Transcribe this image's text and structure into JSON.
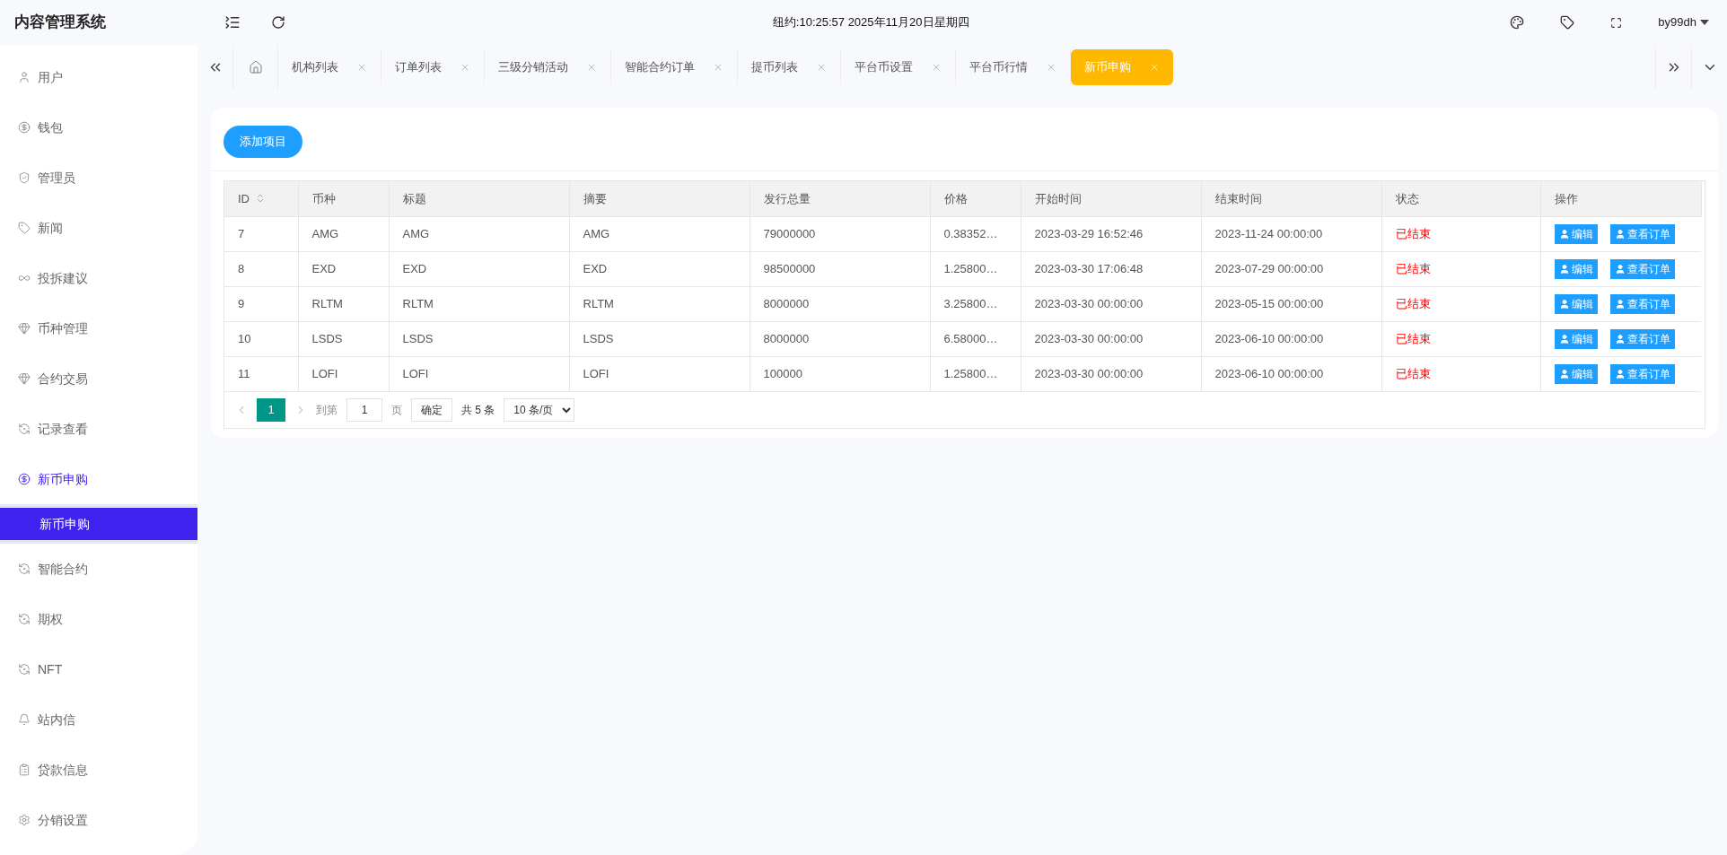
{
  "app_title": "内容管理系统",
  "header": {
    "clock": "纽约:10:25:57 2025年11月20日星期四",
    "user": "by99dh"
  },
  "sidebar": {
    "items": [
      {
        "label": "用户",
        "kind": "user",
        "expanded": false
      },
      {
        "label": "钱包",
        "kind": "dollar",
        "expanded": false
      },
      {
        "label": "管理员",
        "kind": "shield",
        "expanded": false
      },
      {
        "label": "新闻",
        "kind": "tag",
        "expanded": false
      },
      {
        "label": "投拆建议",
        "kind": "link",
        "expanded": false
      },
      {
        "label": "币种管理",
        "kind": "gem",
        "expanded": false
      },
      {
        "label": "合约交易",
        "kind": "gem",
        "expanded": false
      },
      {
        "label": "记录查看",
        "kind": "cycle",
        "expanded": false
      },
      {
        "label": "新币申购",
        "kind": "dollar",
        "expanded": true,
        "children": [
          {
            "label": "新币申购",
            "selected": true
          }
        ]
      },
      {
        "label": "智能合约",
        "kind": "cycle",
        "expanded": false
      },
      {
        "label": "期权",
        "kind": "cycle",
        "expanded": false
      },
      {
        "label": "NFT",
        "kind": "cycle",
        "expanded": false
      },
      {
        "label": "站内信",
        "kind": "bell",
        "expanded": false
      },
      {
        "label": "贷款信息",
        "kind": "clipboard",
        "expanded": false
      },
      {
        "label": "分销设置",
        "kind": "gear",
        "expanded": false
      }
    ]
  },
  "tabs": [
    {
      "label": "机构列表",
      "selected": false
    },
    {
      "label": "订单列表",
      "selected": false
    },
    {
      "label": "三级分销活动",
      "selected": false
    },
    {
      "label": "智能合约订单",
      "selected": false
    },
    {
      "label": "提币列表",
      "selected": false
    },
    {
      "label": "平台币设置",
      "selected": false
    },
    {
      "label": "平台币行情",
      "selected": false
    },
    {
      "label": "新币申购",
      "selected": true
    }
  ],
  "add_button": "添加项目",
  "table": {
    "columns": [
      {
        "label": "ID",
        "sortable": true
      },
      {
        "label": "币种",
        "sortable": false
      },
      {
        "label": "标题",
        "sortable": false
      },
      {
        "label": "摘要",
        "sortable": false
      },
      {
        "label": "发行总量",
        "sortable": false
      },
      {
        "label": "价格",
        "sortable": false
      },
      {
        "label": "开始时间",
        "sortable": false
      },
      {
        "label": "结束时间",
        "sortable": false
      },
      {
        "label": "状态",
        "sortable": false
      },
      {
        "label": "操作",
        "sortable": false
      }
    ],
    "rows": [
      {
        "cells": [
          "7",
          "AMG",
          "AMG",
          "AMG",
          "79000000",
          "0.38352…",
          "2023-03-29 16:52:46",
          "2023-11-24 00:00:00"
        ],
        "status": "已结束",
        "actions": [
          "编辑",
          "查看订单"
        ]
      },
      {
        "cells": [
          "8",
          "EXD",
          "EXD",
          "EXD",
          "98500000",
          "1.25800…",
          "2023-03-30 17:06:48",
          "2023-07-29 00:00:00"
        ],
        "status": "已结束",
        "actions": [
          "编辑",
          "查看订单"
        ]
      },
      {
        "cells": [
          "9",
          "RLTM",
          "RLTM",
          "RLTM",
          "8000000",
          "3.25800…",
          "2023-03-30 00:00:00",
          "2023-05-15 00:00:00"
        ],
        "status": "已结束",
        "actions": [
          "编辑",
          "查看订单"
        ]
      },
      {
        "cells": [
          "10",
          "LSDS",
          "LSDS",
          "LSDS",
          "8000000",
          "6.58000…",
          "2023-03-30 00:00:00",
          "2023-06-10 00:00:00"
        ],
        "status": "已结束",
        "actions": [
          "编辑",
          "查看订单"
        ]
      },
      {
        "cells": [
          "11",
          "LOFI",
          "LOFI",
          "LOFI",
          "100000",
          "1.25800…",
          "2023-03-30 00:00:00",
          "2023-06-10 00:00:00"
        ],
        "status": "已结束",
        "actions": [
          "编辑",
          "查看订单"
        ]
      }
    ]
  },
  "pagination": {
    "pages": [
      {
        "label": "1",
        "selected": true
      }
    ],
    "goto_label": "到第",
    "goto_value": "1",
    "page_unit": "页",
    "confirm": "确定",
    "total": "共 5 条",
    "page_size": "10 条/页"
  }
}
